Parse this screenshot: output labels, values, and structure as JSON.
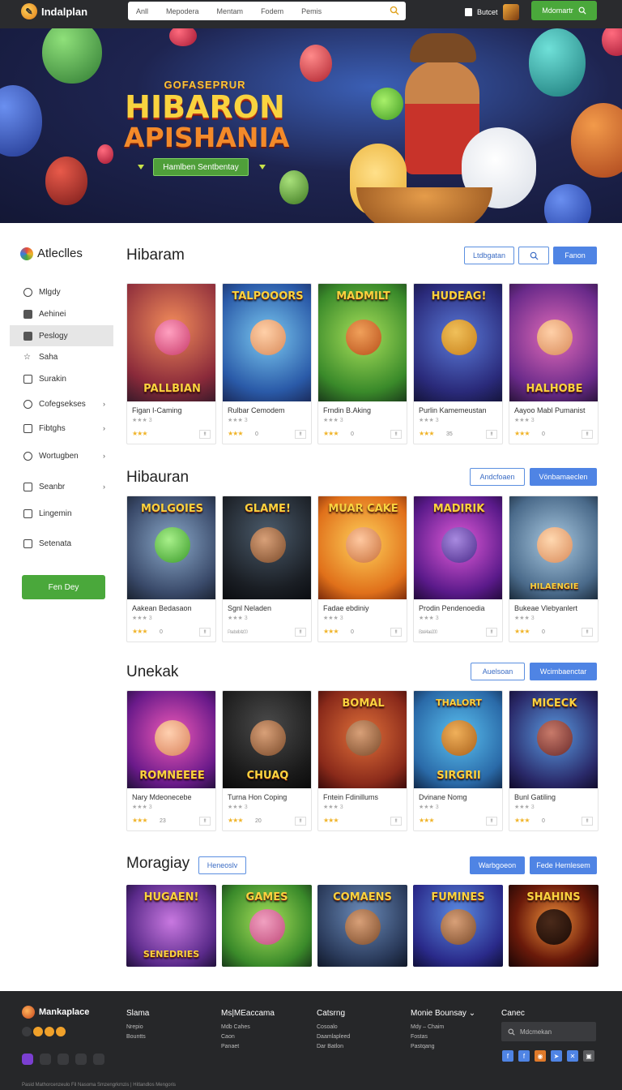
{
  "header": {
    "brand": "Indalplan",
    "search_filters": [
      "Anll",
      "Mepodera",
      "Mentam",
      "Fodem",
      "Pemis"
    ],
    "store_label": "Butcet",
    "cta_label": "Mdomartr"
  },
  "hero": {
    "kicker": "GOFASEPRUR",
    "title_line1": "HIBARON",
    "title_line2": "APISHANIA",
    "button_label": "Hamlben Sentbentay"
  },
  "sidebar": {
    "title": "Atleclles",
    "items": [
      {
        "label": "Mlgdy",
        "chevron": false
      },
      {
        "label": "Aehinei",
        "chevron": false
      },
      {
        "label": "Peslogy",
        "chevron": false
      },
      {
        "label": "Saha",
        "chevron": false
      },
      {
        "label": "Surakin",
        "chevron": false
      },
      {
        "label": "Cofegsekses",
        "chevron": true
      },
      {
        "label": "Fibtghs",
        "chevron": true
      },
      {
        "label": "Wortugben",
        "chevron": true
      },
      {
        "label": "Seanbr",
        "chevron": true
      },
      {
        "label": "Lingemin",
        "chevron": false
      },
      {
        "label": "Setenata",
        "chevron": false
      }
    ],
    "cta_label": "Fen Dey"
  },
  "sections": [
    {
      "title": "Hibaram",
      "buttons": [
        "Ltdbgatan",
        "Fanon"
      ],
      "cards": [
        {
          "art": "PALLBIAN",
          "name": "Figan I-Caming",
          "stars": "★★★",
          "count": "",
          "tag": "!!"
        },
        {
          "art": "TALPOOORS",
          "name": "Rulbar Cemodem",
          "stars": "★★★",
          "count": "0",
          "tag": "!!"
        },
        {
          "art": "MADMILT",
          "name": "Frndin B.Aking",
          "stars": "★★★",
          "count": "0",
          "tag": "!!"
        },
        {
          "art": "HUDEAG!",
          "name": "Purlin Kamemeustan",
          "stars": "★★★",
          "count": "35",
          "tag": "!!"
        },
        {
          "art": "HALHOBE",
          "name": "Aayoo Mabl Pumanist",
          "stars": "★★★",
          "count": "0",
          "tag": "!!"
        }
      ]
    },
    {
      "title": "Hibauran",
      "buttons": [
        "Andcfoaen",
        "Vönbamaeclen"
      ],
      "cards": [
        {
          "art": "MOLGOIES",
          "name": "Aakean Bedasaon",
          "stars": "★★★",
          "count": "0",
          "tag": "!!"
        },
        {
          "art": "GLAME!",
          "name": "Sgnl Neladen",
          "stars": "",
          "count": "",
          "tag": "!!"
        },
        {
          "art": "MUAR CAKE",
          "name": "Fadae ebdiniy",
          "stars": "★★★",
          "count": "0",
          "tag": "!!"
        },
        {
          "art": "MADIRIK",
          "name": "Prodin Pendenoedia",
          "stars": "",
          "count": "",
          "tag": "!!"
        },
        {
          "art": "HILAENGIE",
          "name": "Bukeae Vlebyanlert",
          "stars": "★★★",
          "count": "0",
          "tag": "!!"
        }
      ]
    },
    {
      "title": "Unekak",
      "buttons": [
        "Auelsoan",
        "Wcimbaenctar"
      ],
      "cards": [
        {
          "art": "ROMNEEEE",
          "name": "Nary Mdeonecebe",
          "stars": "★★★",
          "count": "23",
          "tag": "!!"
        },
        {
          "art": "CHUAQ",
          "name": "Turna Hon Coping",
          "stars": "★★★",
          "count": "20",
          "tag": "!!"
        },
        {
          "art": "BOMAL",
          "name": "Fntein Fdinillums",
          "stars": "★★★",
          "count": "",
          "tag": "!!"
        },
        {
          "art": "SIRGRII",
          "name": "Dvinane Nomg",
          "stars": "★★★",
          "count": "",
          "tag": "!!"
        },
        {
          "art": "MICECK",
          "name": "Bunl Gatiling",
          "stars": "★★★",
          "count": "0",
          "tag": "!!"
        }
      ]
    },
    {
      "title": "Moragiay",
      "buttons": [
        "Heneoslv",
        "Warbgoeon",
        "Fede Hernlesem"
      ],
      "cards": [
        {
          "art": "HUGAEN!",
          "name": "",
          "stars": "",
          "count": "",
          "tag": ""
        },
        {
          "art": "GAMES",
          "name": "",
          "stars": "",
          "count": "",
          "tag": ""
        },
        {
          "art": "COMAENS",
          "name": "",
          "stars": "",
          "count": "",
          "tag": ""
        },
        {
          "art": "FUMINES",
          "name": "",
          "stars": "",
          "count": "",
          "tag": ""
        },
        {
          "art": "SHAHINS",
          "name": "",
          "stars": "",
          "count": "",
          "tag": ""
        }
      ]
    }
  ],
  "footer": {
    "brand": "Mankaplace",
    "columns": [
      {
        "title": "Slama",
        "links": [
          "Nrepio",
          "Bountts"
        ]
      },
      {
        "title": "Ms|MEaccama",
        "links": [
          "Mdb Cahes",
          "Caon",
          "Panaet"
        ]
      },
      {
        "title": "Catsrng",
        "links": [
          "Cosoalo",
          "Daamlapleed",
          "Dar Batlon"
        ]
      },
      {
        "title": "Monie Bounsay",
        "links": [
          "Mdy – Chaim",
          "Fostas",
          "Pastqang"
        ]
      },
      {
        "title": "Canec",
        "links": []
      }
    ],
    "search_placeholder": "Mdcmekan",
    "copyright": "Pasid Mathorcenzeulo Fil Nasoma Smzengrkmzis | Hitlandlos Mengoris"
  },
  "colors": {
    "green_accent": "#4aa83b",
    "blue_accent": "#4f84e4",
    "dark_header": "#2a2b2e",
    "footer_bg": "#262729"
  }
}
